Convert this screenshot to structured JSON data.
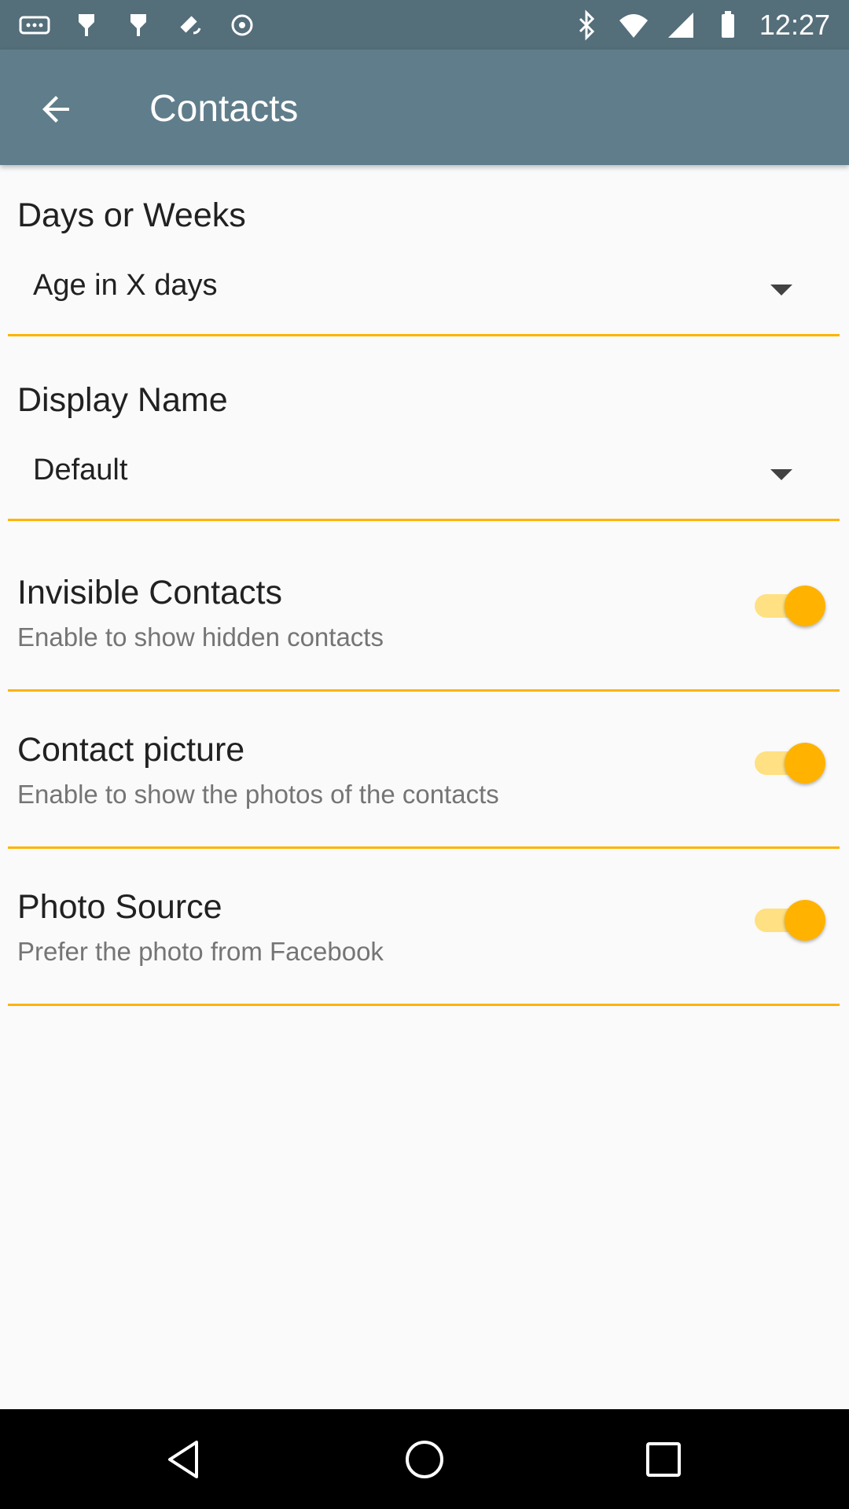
{
  "status_bar": {
    "time": "12:27",
    "left_icons": [
      "more-icon",
      "notification-icon",
      "notification-icon",
      "fake-gps-icon",
      "location-icon"
    ],
    "right_icons": [
      "bluetooth-icon",
      "wifi-icon",
      "signal-icon",
      "battery-icon"
    ]
  },
  "app_bar": {
    "title": "Contacts",
    "background": "#607d8b"
  },
  "settings": {
    "days_or_weeks": {
      "title": "Days or Weeks",
      "value": "Age in X days"
    },
    "display_name": {
      "title": "Display Name",
      "value": "Default"
    },
    "invisible_contacts": {
      "title": "Invisible Contacts",
      "subtitle": "Enable to show hidden contacts",
      "enabled": true
    },
    "contact_picture": {
      "title": "Contact picture",
      "subtitle": "Enable to show the photos of the contacts",
      "enabled": true
    },
    "photo_source": {
      "title": "Photo Source",
      "subtitle": "Prefer the photo from Facebook",
      "enabled": true
    }
  },
  "accent_color": "#ffb300",
  "nav_bar": {
    "buttons": [
      "back-icon",
      "home-icon",
      "recents-icon"
    ]
  }
}
